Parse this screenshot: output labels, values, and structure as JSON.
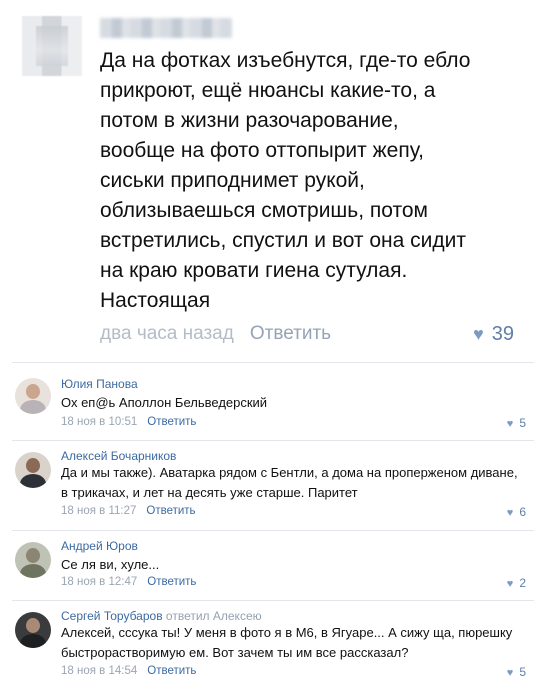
{
  "top_comment": {
    "lines": [
      "Да на фотках изъебнутся, где-то ебло",
      "прикроют, ещё нюансы какие-то, а",
      "потом в жизни разочарование,",
      "вообще на фото оттопырит жепу,",
      "сиськи приподнимет рукой,",
      "облизываешься смотришь, потом",
      "встретились, спустил и вот она сидит",
      "на краю кровати гиена сутулая.",
      "Настоящая"
    ],
    "time": "два часа назад",
    "reply_label": "Ответить",
    "likes": "39",
    "like_icon": "heart-icon"
  },
  "comments": [
    {
      "name": "Юлия Панова",
      "lines": [
        "Ох еп@ь Аполлон Бельведерский"
      ],
      "time": "18 ноя в 10:51",
      "reply_label": "Ответить",
      "likes": "5"
    },
    {
      "name": "Алексей Бочарников",
      "lines": [
        "Да и мы также). Аватарка рядом с Бентли, а дома на проперженом диване,",
        "в трикачах, и лет на десять уже старше. Паритет"
      ],
      "time": "18 ноя в 11:27",
      "reply_label": "Ответить",
      "likes": "6"
    },
    {
      "name": "Андрей Юров",
      "lines": [
        "Се ля ви, хуле..."
      ],
      "time": "18 ноя в 12:47",
      "reply_label": "Ответить",
      "likes": "2"
    },
    {
      "name": "Сергей Торубаров",
      "replied_to": "ответил Алексею",
      "lines": [
        "Алексей, сссука ты! У меня в фото я в М6, в Ягуаре... А сижу ща, пюрешку",
        "быстрорастворимую ем. Вот зачем ты им все рассказал?"
      ],
      "time": "18 ноя в 14:54",
      "reply_label": "Ответить",
      "likes": "5"
    }
  ],
  "colors": {
    "name": "#3c6aa1",
    "meta": "#9aa5b2",
    "like": "#5e7fa8"
  }
}
